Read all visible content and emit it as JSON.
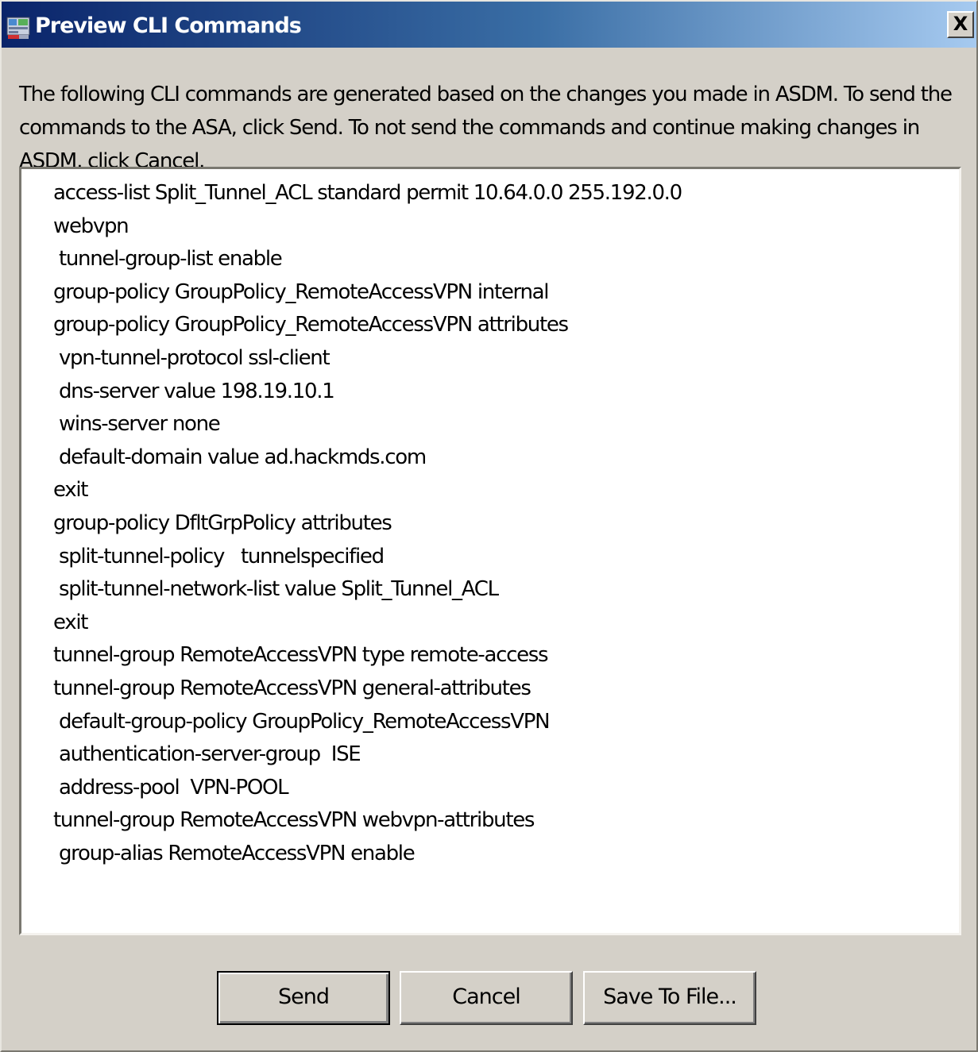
{
  "window": {
    "title": "Preview CLI Commands",
    "close_label": "X",
    "icon": "asdm-app-icon"
  },
  "description": "The following CLI commands are generated based on the changes you made in ASDM. To send the commands to the ASA, click Send. To not send the commands and continue making changes in ASDM, click Cancel.",
  "cli_commands": [
    "access-list Split_Tunnel_ACL standard permit 10.64.0.0 255.192.0.0",
    "webvpn",
    " tunnel-group-list enable",
    "group-policy GroupPolicy_RemoteAccessVPN internal",
    "group-policy GroupPolicy_RemoteAccessVPN attributes",
    " vpn-tunnel-protocol ssl-client",
    " dns-server value 198.19.10.1",
    " wins-server none",
    " default-domain value ad.hackmds.com",
    "exit",
    "group-policy DfltGrpPolicy attributes",
    " split-tunnel-policy   tunnelspecified",
    " split-tunnel-network-list value Split_Tunnel_ACL",
    "exit",
    "tunnel-group RemoteAccessVPN type remote-access",
    "tunnel-group RemoteAccessVPN general-attributes",
    " default-group-policy GroupPolicy_RemoteAccessVPN",
    " authentication-server-group  ISE",
    " address-pool  VPN-POOL",
    "tunnel-group RemoteAccessVPN webvpn-attributes",
    " group-alias RemoteAccessVPN enable"
  ],
  "buttons": {
    "send": "Send",
    "cancel": "Cancel",
    "save": "Save To File..."
  },
  "colors": {
    "titlebar_start": "#0a246a",
    "titlebar_end": "#a6caf0",
    "dialog_bg": "#d4d0c8",
    "panel_bg": "#ffffff"
  }
}
